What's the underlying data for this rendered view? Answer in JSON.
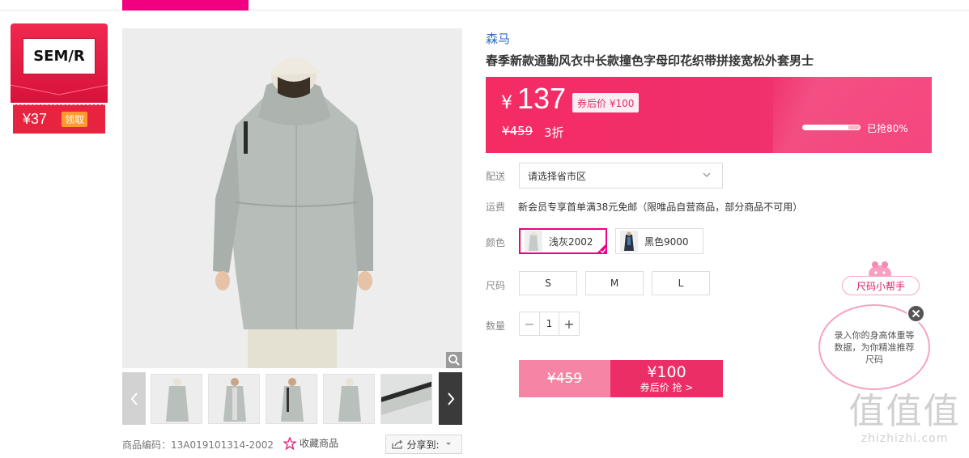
{
  "brand_coupon": {
    "logo_text": "SEM/R",
    "amount": "¥37",
    "claim_label": "领取"
  },
  "gallery": {
    "main_alt": "model wearing light grey long hooded trench coat, back view",
    "thumbnails": [
      "thumb-1",
      "thumb-2",
      "thumb-3",
      "thumb-4",
      "thumb-5",
      "thumb-6"
    ]
  },
  "product": {
    "brand": "森马",
    "title": "春季新款通勤风衣中长款撞色字母印花织带拼接宽松外套男士",
    "sku_code": "商品编码：13A019101314-2002",
    "favorite_label": "收藏商品",
    "share_label": "分享到:"
  },
  "price": {
    "yen": "¥",
    "current": "137",
    "after_coupon": "券后价 ¥100",
    "original": "¥459",
    "discount": "3折",
    "sold_percent": 80,
    "sold_text": "已抢80%"
  },
  "delivery": {
    "label": "配送",
    "placeholder": "请选择省市区"
  },
  "shipping": {
    "label": "运费",
    "text": "新会员专享首单满38元免邮（限唯品自营商品，部分商品不可用）"
  },
  "color": {
    "label": "颜色",
    "options": [
      {
        "name": "浅灰2002",
        "selected": true,
        "swatch": "#c7cbc8"
      },
      {
        "name": "黑色9000",
        "selected": false,
        "swatch": "#2a3444"
      }
    ]
  },
  "size": {
    "label": "尺码",
    "options": [
      "S",
      "M",
      "L"
    ]
  },
  "quantity": {
    "label": "数量",
    "value": "1",
    "minus": "−",
    "plus": "+"
  },
  "buy_button": {
    "original": "¥459",
    "price": "¥100",
    "sub": "券后价 抢 >"
  },
  "size_helper": {
    "title": "尺码小帮手",
    "text": "录入你的身高体重等数据，为你精准推荐尺码"
  },
  "watermark": {
    "big": "值值值",
    "small": "zhizhizhi.com"
  },
  "colors": {
    "accent": "#f10180",
    "price_bg": "#f0306d",
    "link": "#2f6bbf"
  }
}
